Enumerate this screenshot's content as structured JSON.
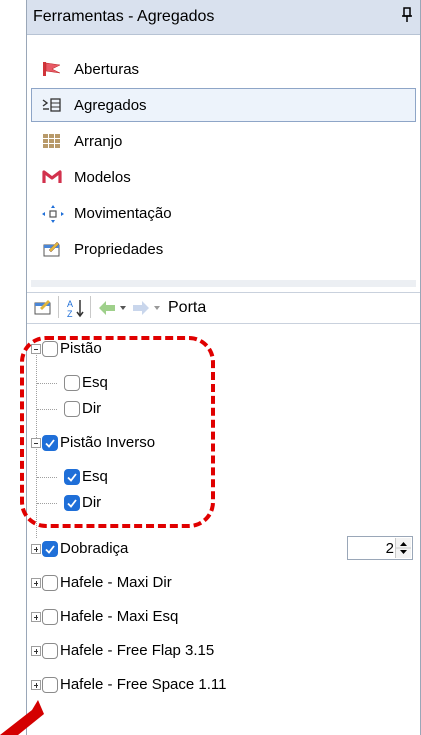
{
  "window": {
    "title": "Ferramentas - Agregados"
  },
  "nav": {
    "items": [
      {
        "label": "Aberturas",
        "icon": "flag-icon"
      },
      {
        "label": "Agregados",
        "icon": "aggregates-icon",
        "selected": true
      },
      {
        "label": "Arranjo",
        "icon": "grid-icon"
      },
      {
        "label": "Modelos",
        "icon": "models-icon"
      },
      {
        "label": "Movimentação",
        "icon": "move-icon"
      },
      {
        "label": "Propriedades",
        "icon": "properties-icon"
      }
    ]
  },
  "toolbar": {
    "label": "Porta"
  },
  "tree": {
    "rows": [
      {
        "label": "Pistão",
        "checked": false,
        "level": 0,
        "expander": "minus"
      },
      {
        "label": "Esq",
        "checked": false,
        "level": 1
      },
      {
        "label": "Dir",
        "checked": false,
        "level": 1
      },
      {
        "label": "Pistão Inverso",
        "checked": true,
        "level": 0,
        "expander": "minus"
      },
      {
        "label": "Esq",
        "checked": true,
        "level": 1
      },
      {
        "label": "Dir",
        "checked": true,
        "level": 1
      },
      {
        "label": "Dobradiça",
        "checked": true,
        "level": 0,
        "expander": "plus",
        "spinner_value": "2"
      },
      {
        "label": "Hafele - Maxi Dir",
        "checked": false,
        "level": 0,
        "expander": "plus"
      },
      {
        "label": "Hafele - Maxi Esq",
        "checked": false,
        "level": 0,
        "expander": "plus"
      },
      {
        "label": "Hafele - Free Flap 3.15",
        "checked": false,
        "level": 0,
        "expander": "plus"
      },
      {
        "label": "Hafele - Free Space 1.11",
        "checked": false,
        "level": 0,
        "expander": "plus"
      }
    ]
  },
  "colors": {
    "checkbox_checked": "#1f6fd8",
    "highlight_dashes": "#e00000",
    "titlebar": "#d9e1ee"
  }
}
